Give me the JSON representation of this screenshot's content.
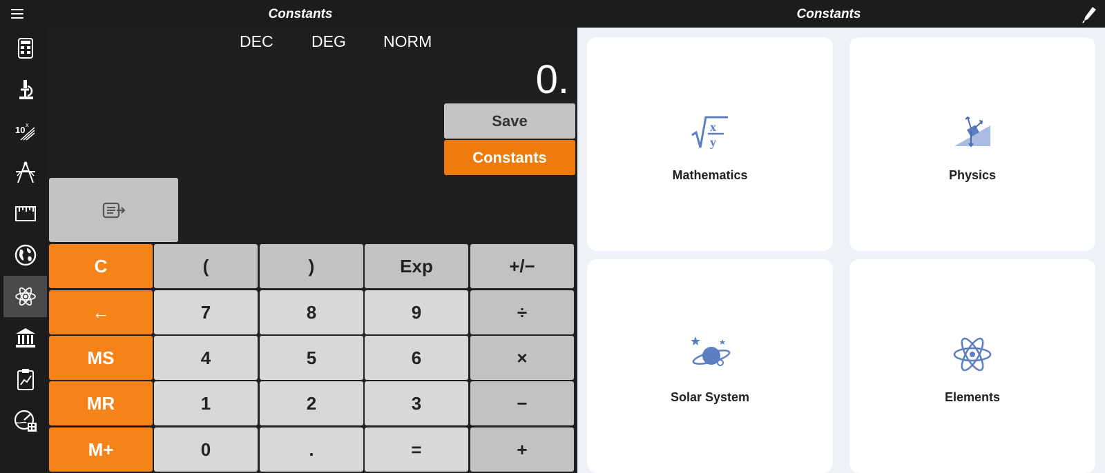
{
  "header": {
    "title_left": "Constants",
    "title_right": "Constants",
    "menu_icon": "hamburger-menu-icon",
    "edit_icon": "pen-icon"
  },
  "sidebar": {
    "items": [
      {
        "icon": "calculator-icon"
      },
      {
        "icon": "microscope-icon"
      },
      {
        "icon": "scientific-notation-icon"
      },
      {
        "icon": "geometry-icon"
      },
      {
        "icon": "ruler-icon"
      },
      {
        "icon": "globe-icon"
      },
      {
        "icon": "atom-icon",
        "active": true
      },
      {
        "icon": "bank-icon"
      },
      {
        "icon": "clipboard-chart-icon"
      },
      {
        "icon": "gauge-calculator-icon"
      }
    ]
  },
  "calculator": {
    "modes": [
      "DEC",
      "DEG",
      "NORM"
    ],
    "display": "0.",
    "save_label": "Save",
    "constants_label": "Constants",
    "history_icon": "history-list-icon",
    "keys": [
      [
        "C",
        "(",
        ")",
        "Exp",
        "+/−"
      ],
      [
        "←",
        "7",
        "8",
        "9",
        "÷"
      ],
      [
        "MS",
        "4",
        "5",
        "6",
        "×"
      ],
      [
        "MR",
        "1",
        "2",
        "3",
        "−"
      ],
      [
        "M+",
        "0",
        ".",
        "=",
        "+"
      ]
    ]
  },
  "categories": [
    {
      "label": "Mathematics",
      "icon": "sqrt-fraction-icon"
    },
    {
      "label": "Physics",
      "icon": "inclined-plane-icon"
    },
    {
      "label": "Solar System",
      "icon": "planet-icon"
    },
    {
      "label": "Elements",
      "icon": "atom-icon"
    }
  ],
  "colors": {
    "accent_orange": "#f58318",
    "key_light": "#d8d8d8",
    "key_mid": "#c2c2c2",
    "panel_bg": "#eef1f5",
    "icon_blue": "#5b7fc0"
  }
}
